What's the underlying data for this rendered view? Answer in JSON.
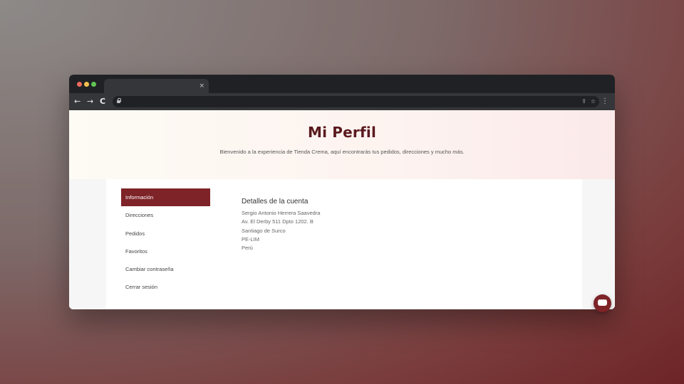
{
  "browser": {
    "tab_close": "×",
    "nav_back": "←",
    "nav_forward": "→",
    "nav_reload": "C",
    "share_icon": "⇪",
    "bookmark_icon": "☆",
    "menu_icon": "⋮",
    "address": ""
  },
  "hero": {
    "title": "Mi Perfil",
    "subtitle": "Bienvenido a la experiencia de Tienda Crema, aquí encontrarás tus pedidos, direcciones y mucho más."
  },
  "sidebar": {
    "items": [
      {
        "label": "Información",
        "active": true
      },
      {
        "label": "Direcciones",
        "active": false
      },
      {
        "label": "Pedidos",
        "active": false
      },
      {
        "label": "Favoritos",
        "active": false
      },
      {
        "label": "Cambiar contraseña",
        "active": false
      },
      {
        "label": "Cerrar sesión",
        "active": false
      }
    ]
  },
  "details": {
    "title": "Detalles de la cuenta",
    "lines": [
      "Sergio Antonio Herrera Saavedra",
      "Av. El Derby 511 Dpto 1202. B",
      "Santiago de Surco",
      "PE-LIM",
      "Perú"
    ]
  },
  "colors": {
    "accent": "#7e2328",
    "title": "#5a1a1f"
  }
}
